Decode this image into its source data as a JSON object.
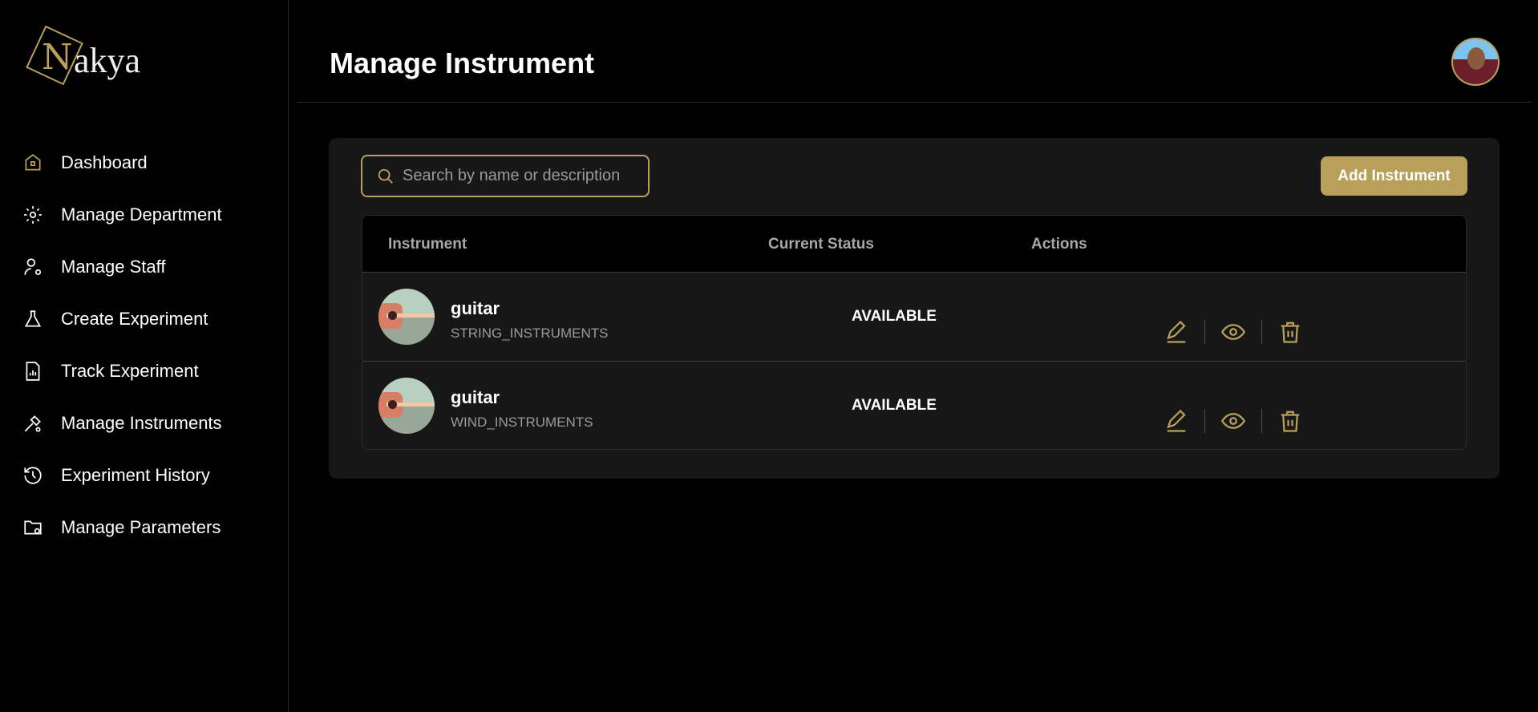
{
  "brand": {
    "logo_text": "Nakya",
    "accent": "#b8a05a"
  },
  "sidebar": {
    "items": [
      {
        "label": "Dashboard",
        "icon": "home-icon"
      },
      {
        "label": "Manage Department",
        "icon": "gear-icon"
      },
      {
        "label": "Manage Staff",
        "icon": "user-gear-icon"
      },
      {
        "label": "Create Experiment",
        "icon": "flask-icon"
      },
      {
        "label": "Track Experiment",
        "icon": "file-chart-icon"
      },
      {
        "label": "Manage Instruments",
        "icon": "tools-icon"
      },
      {
        "label": "Experiment History",
        "icon": "history-icon"
      },
      {
        "label": "Manage Parameters",
        "icon": "folder-gear-icon"
      }
    ]
  },
  "header": {
    "title": "Manage Instrument"
  },
  "toolbar": {
    "search_placeholder": "Search by name or description",
    "search_value": "",
    "add_label": "Add Instrument"
  },
  "table": {
    "columns": [
      "Instrument",
      "Current Status",
      "Actions"
    ],
    "rows": [
      {
        "name": "guitar",
        "category": "STRING_INSTRUMENTS",
        "status": "AVAILABLE"
      },
      {
        "name": "guitar",
        "category": "WIND_INSTRUMENTS",
        "status": "AVAILABLE"
      }
    ]
  }
}
